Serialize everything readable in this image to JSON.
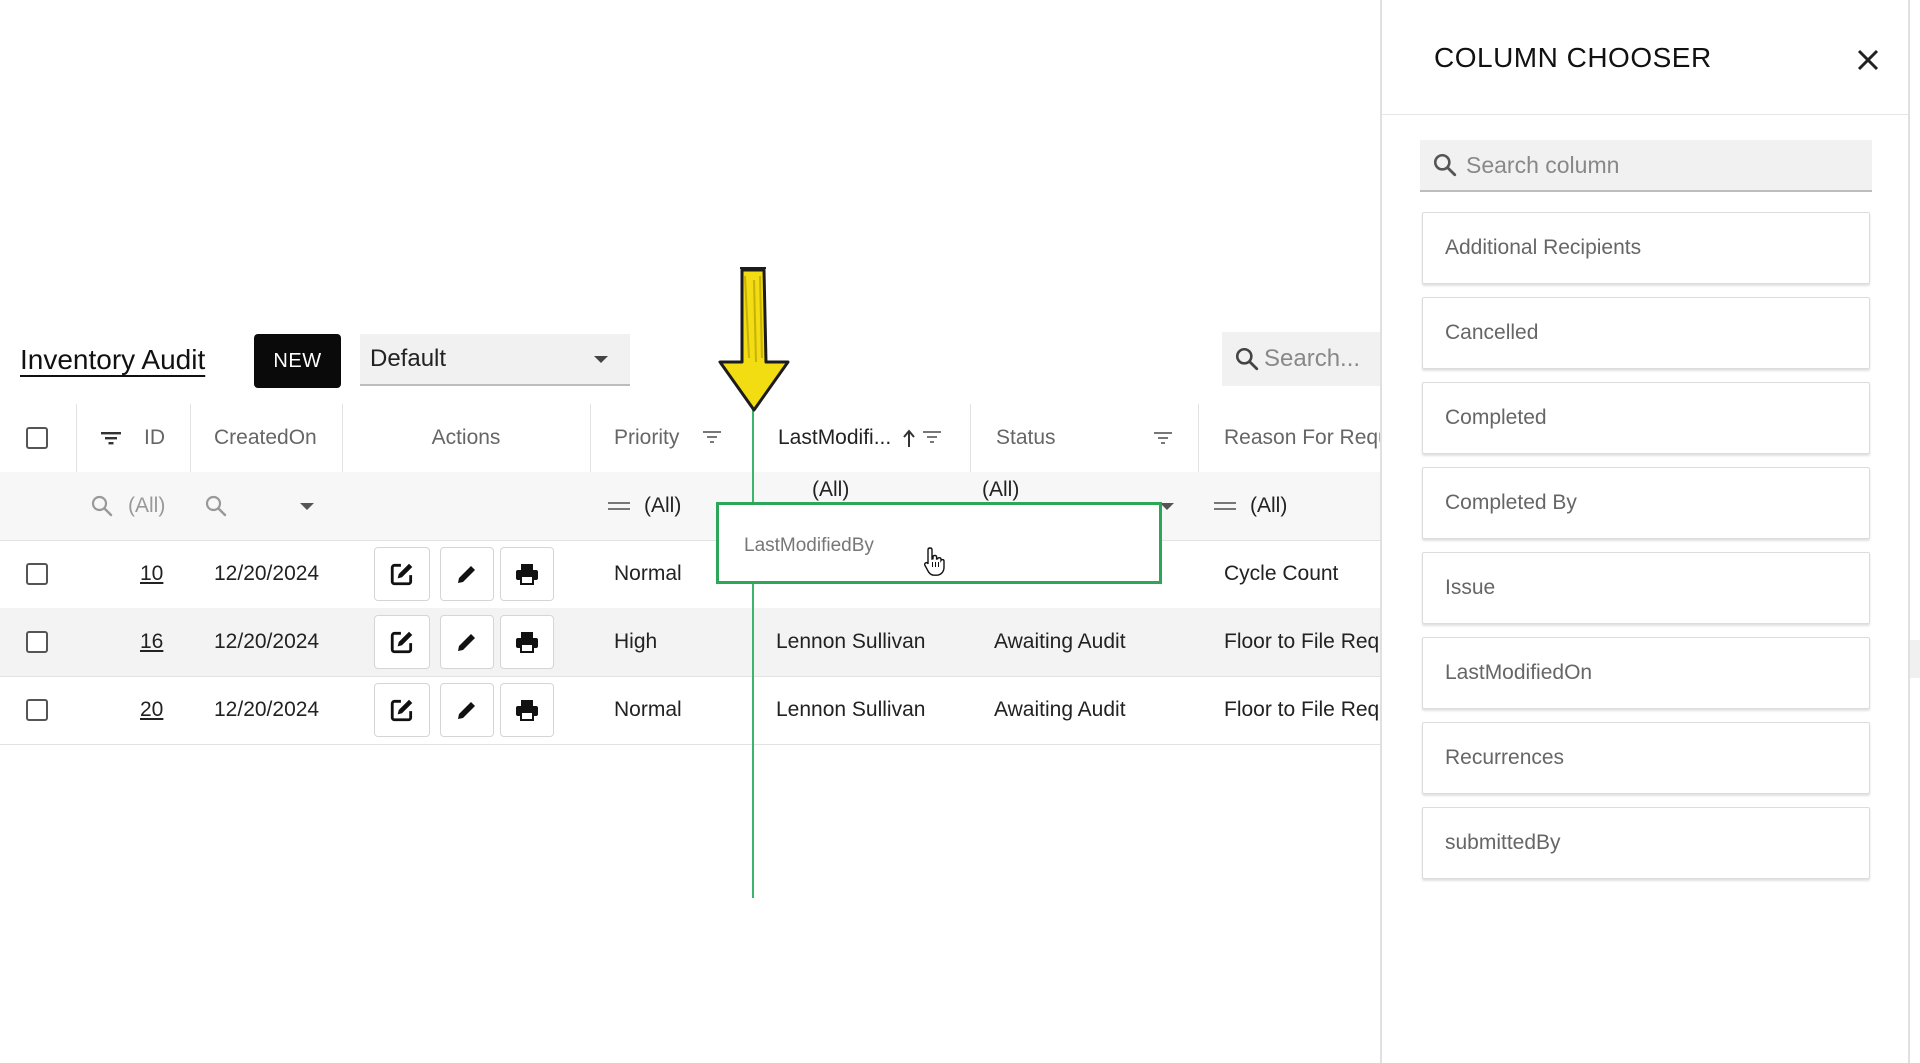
{
  "toolbar": {
    "title": "Inventory Audit",
    "new_label": "NEW",
    "view_value": "Default",
    "search_placeholder": "Search..."
  },
  "grid": {
    "headers": {
      "id": "ID",
      "created_on": "CreatedOn",
      "actions": "Actions",
      "priority": "Priority",
      "last_modified": "LastModifi...",
      "status": "Status",
      "reason": "Reason For Requ"
    },
    "filters": {
      "id": "(All)",
      "priority": "(All)",
      "last_modified": "(All)",
      "status": "(All)",
      "reason": "(All)"
    },
    "rows": [
      {
        "id": "10",
        "created_on": "12/20/2024",
        "priority": "Normal",
        "last_modified_by": "",
        "status": "",
        "reason": "Cycle Count"
      },
      {
        "id": "16",
        "created_on": "12/20/2024",
        "priority": "High",
        "last_modified_by": "Lennon Sullivan",
        "status": "Awaiting Audit",
        "reason": "Floor to File Requ"
      },
      {
        "id": "20",
        "created_on": "12/20/2024",
        "priority": "Normal",
        "last_modified_by": "Lennon Sullivan",
        "status": "Awaiting Audit",
        "reason": "Floor to File Requ"
      }
    ]
  },
  "drag": {
    "label": "LastModifiedBy",
    "arrow_color": "#f2dc12",
    "drop_line_color": "#3bb56a"
  },
  "chooser": {
    "title": "COLUMN CHOOSER",
    "search_placeholder": "Search column",
    "items": [
      {
        "label": "Additional Recipients"
      },
      {
        "label": "Cancelled"
      },
      {
        "label": "Completed"
      },
      {
        "label": "Completed By"
      },
      {
        "label": "Issue"
      },
      {
        "label": "LastModifiedOn"
      },
      {
        "label": "Recurrences"
      },
      {
        "label": "submittedBy"
      }
    ]
  }
}
